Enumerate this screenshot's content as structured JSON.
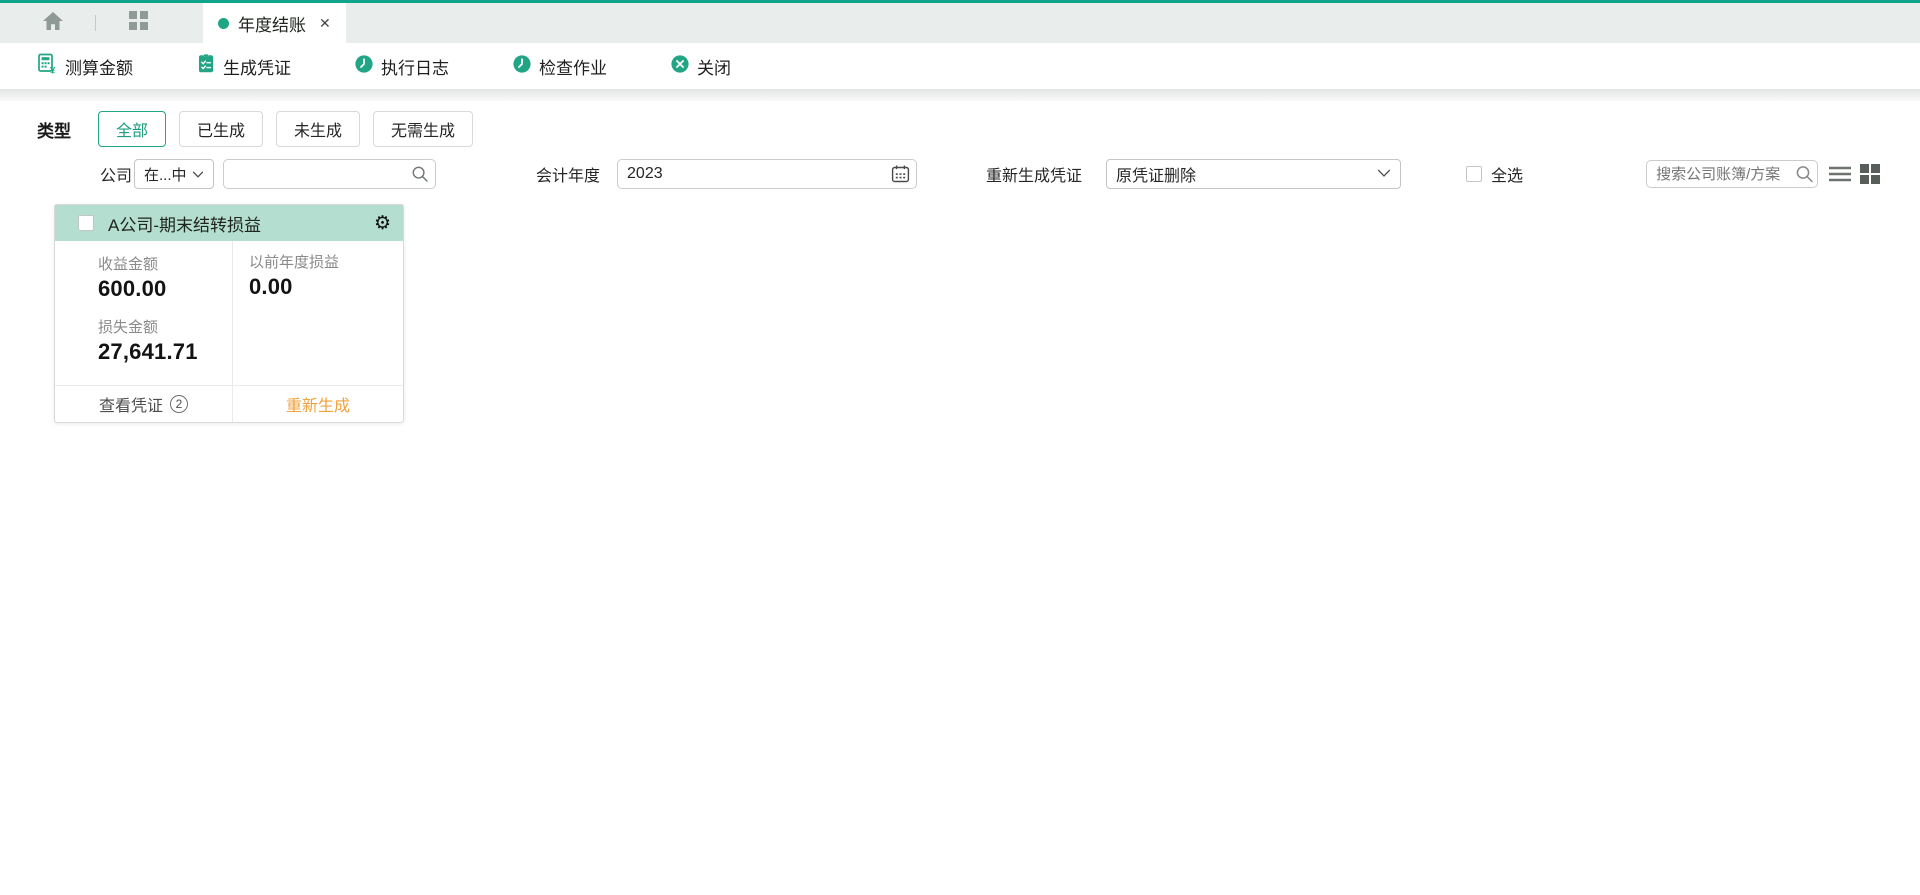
{
  "colors": {
    "accent": "#21a584",
    "topline": "#10a58a",
    "card_header_bg": "#b4dfd0",
    "regenerate_orange": "#f0a23c"
  },
  "icons": {
    "tab_close": "✕",
    "gear": "⚙"
  },
  "topbar": {
    "tab_label": "年度结账"
  },
  "toolbar": {
    "buttons": [
      {
        "label": "测算金额",
        "icon": "calculator-icon"
      },
      {
        "label": "生成凭证",
        "icon": "voucher-icon"
      },
      {
        "label": "执行日志",
        "icon": "clock-icon"
      },
      {
        "label": "检查作业",
        "icon": "clock-icon"
      },
      {
        "label": "关闭",
        "icon": "close-circle-icon"
      }
    ]
  },
  "filters": {
    "type_label": "类型",
    "type_options": [
      {
        "label": "全部",
        "active": true
      },
      {
        "label": "已生成",
        "active": false
      },
      {
        "label": "未生成",
        "active": false
      },
      {
        "label": "无需生成",
        "active": false
      }
    ],
    "company_label": "公司",
    "company_operator": "在...中",
    "company_keyword_value": "",
    "fiscal_year_label": "会计年度",
    "fiscal_year_value": "2023",
    "regen_voucher_label": "重新生成凭证",
    "regen_voucher_value": "原凭证删除",
    "select_all_label": "全选",
    "search_placeholder": "搜索公司账簿/方案"
  },
  "card": {
    "title": "A公司-期末结转损益",
    "checked": false,
    "columns": [
      {
        "items": [
          {
            "label": "收益金额",
            "value": "600.00"
          },
          {
            "label": "损失金额",
            "value": "27,641.71"
          }
        ]
      },
      {
        "items": [
          {
            "label": "以前年度损益",
            "value": "0.00"
          }
        ]
      }
    ],
    "footer": {
      "view_voucher_label": "查看凭证",
      "voucher_count": "2",
      "regenerate_label": "重新生成"
    }
  }
}
